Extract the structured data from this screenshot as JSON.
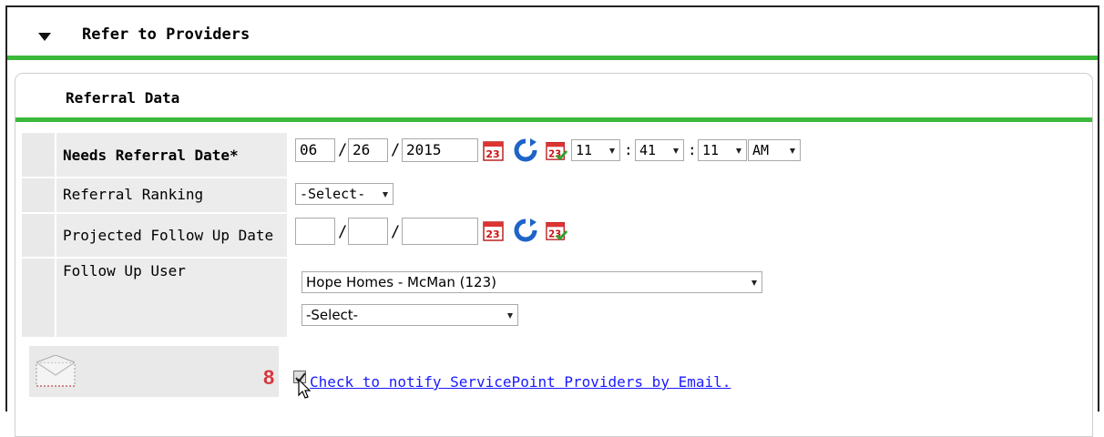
{
  "section": {
    "title": "Refer to Providers"
  },
  "panel": {
    "title": "Referral Data"
  },
  "needs_referral_date": {
    "label": "Needs Referral Date",
    "required_marker": "*",
    "month": "06",
    "day": "26",
    "year": "2015",
    "hour": "11",
    "minute": "41",
    "second": "11",
    "ampm": "AM",
    "sep_slash": "/",
    "sep_colon": ":"
  },
  "referral_ranking": {
    "label": "Referral Ranking",
    "value": "-Select-"
  },
  "projected_follow_up_date": {
    "label": "Projected Follow Up Date",
    "month": "",
    "day": "",
    "year": ""
  },
  "follow_up_user": {
    "label": "Follow Up User",
    "provider": "Hope Homes - McMan (123)",
    "user": "-Select-"
  },
  "notify": {
    "step_number": "8",
    "link_text": "Check to notify ServicePoint Providers by Email.",
    "checked": true
  },
  "colors": {
    "accent_green": "#3cb83a",
    "link_blue": "#1a1aff",
    "step_red": "#d9363e"
  },
  "icons": [
    "collapse-triangle-icon",
    "calendar-icon",
    "refresh-icon",
    "calendar-today-icon",
    "envelope-icon",
    "mouse-cursor-icon"
  ]
}
